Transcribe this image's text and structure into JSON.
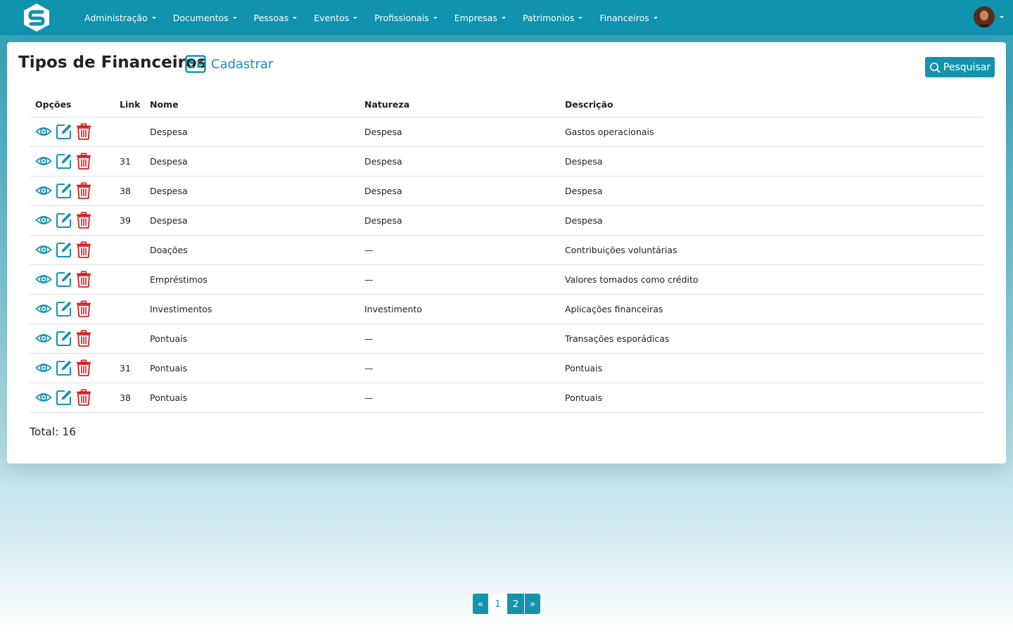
{
  "colors": {
    "brand": "#1593ad",
    "danger": "#d42020",
    "navbar": "#0f93ae"
  },
  "nav": {
    "logo_icon": "brand-logo-s-hexagon",
    "items": [
      "Administração",
      "Documentos",
      "Pessoas",
      "Eventos",
      "Profissionais",
      "Empresas",
      "Patrimonios",
      "Financeiros"
    ],
    "user_avatar": "user-avatar"
  },
  "header": {
    "title": "Tipos de Financeiros",
    "register_label": "Cadastrar",
    "register_icon": "id-card-icon",
    "search_label": "Pesquisar",
    "search_icon": "search-icon"
  },
  "table": {
    "columns": {
      "opcoes": "Opções",
      "link": "Link",
      "nome": "Nome",
      "natureza": "Natureza",
      "descricao": "Descrição"
    },
    "option_icons": [
      "eye-icon",
      "edit-icon",
      "trash-icon"
    ],
    "rows": [
      {
        "link": "",
        "nome": "Despesa",
        "natureza": "Despesa",
        "descricao": "Gastos operacionais"
      },
      {
        "link": "31",
        "nome": "Despesa",
        "natureza": "Despesa",
        "descricao": "Despesa"
      },
      {
        "link": "38",
        "nome": "Despesa",
        "natureza": "Despesa",
        "descricao": "Despesa"
      },
      {
        "link": "39",
        "nome": "Despesa",
        "natureza": "Despesa",
        "descricao": "Despesa"
      },
      {
        "link": "",
        "nome": "Doações",
        "natureza": "—",
        "descricao": "Contribuições voluntárias"
      },
      {
        "link": "",
        "nome": "Empréstimos",
        "natureza": "—",
        "descricao": "Valores tomados como crédito"
      },
      {
        "link": "",
        "nome": "Investimentos",
        "natureza": "Investimento",
        "descricao": "Aplicações financeiras"
      },
      {
        "link": "",
        "nome": "Pontuais",
        "natureza": "—",
        "descricao": "Transações esporádicas"
      },
      {
        "link": "31",
        "nome": "Pontuais",
        "natureza": "—",
        "descricao": "Pontuais"
      },
      {
        "link": "38",
        "nome": "Pontuais",
        "natureza": "—",
        "descricao": "Pontuais"
      }
    ]
  },
  "footer": {
    "total": "Total: 16"
  },
  "pagination": {
    "prev": "«",
    "pages": [
      "1",
      "2"
    ],
    "next": "»",
    "current": "1"
  }
}
